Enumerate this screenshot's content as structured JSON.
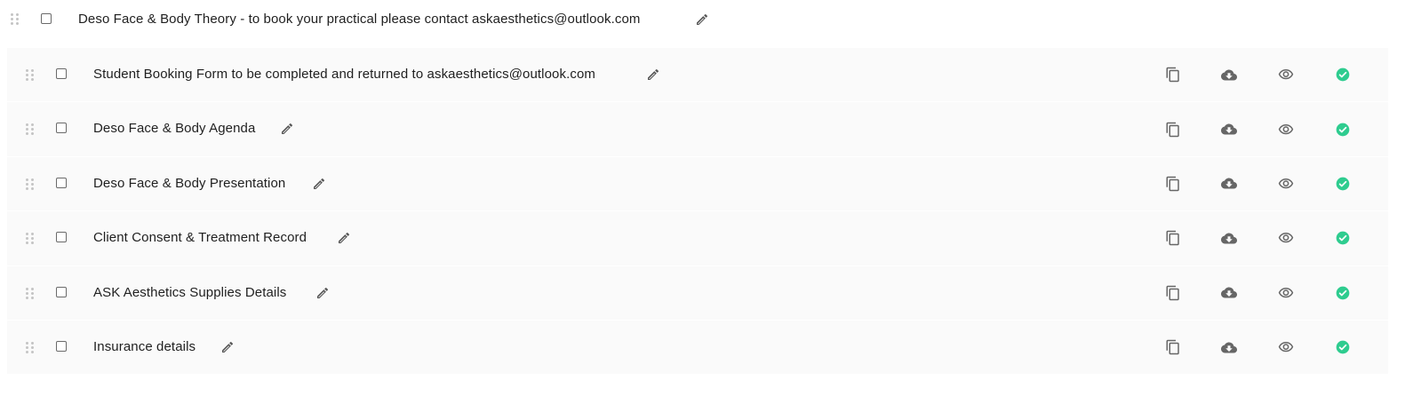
{
  "section": {
    "title": "Deso Face & Body Theory - to book your practical please contact askaesthetics@outlook.com"
  },
  "items": [
    {
      "title": "Student Booking Form to be completed and returned to askaesthetics@outlook.com"
    },
    {
      "title": "Deso Face & Body Agenda"
    },
    {
      "title": "Deso Face & Body Presentation"
    },
    {
      "title": "Client Consent & Treatment Record"
    },
    {
      "title": "ASK Aesthetics Supplies Details"
    },
    {
      "title": "Insurance details"
    }
  ],
  "icons": {
    "drag": "drag-handle-icon",
    "edit": "pencil-icon",
    "copy": "copy-icon",
    "download": "cloud-download-icon",
    "view": "eye-icon",
    "published": "check-circle-icon"
  },
  "colors": {
    "published_green": "#2ecc8f",
    "icon_gray": "#666666",
    "row_background": "#fafafa"
  }
}
